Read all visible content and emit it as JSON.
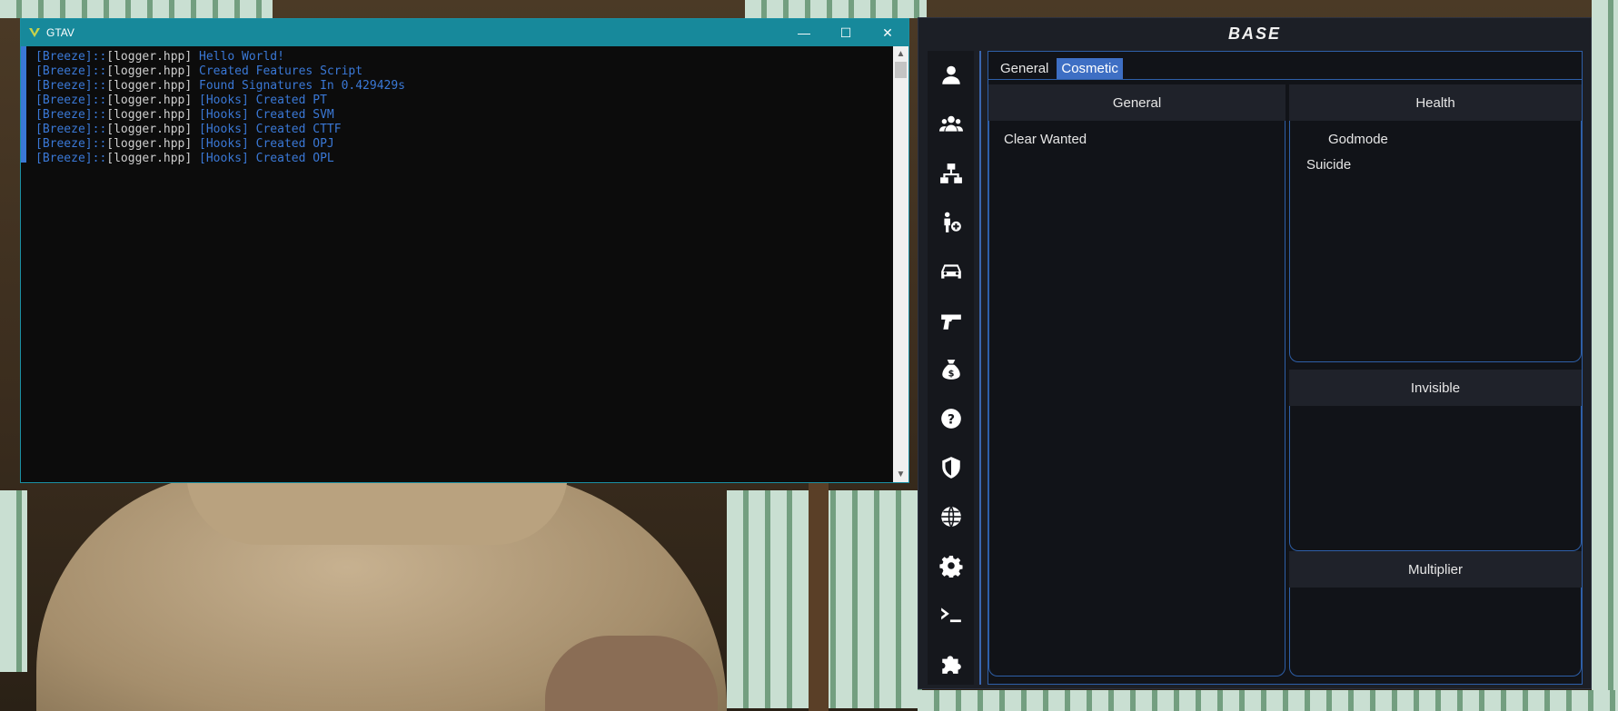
{
  "console": {
    "title": "GTAV",
    "controls": {
      "minimize": "—",
      "maximize": "☐",
      "close": "✕"
    },
    "lines": [
      {
        "tag": "[Breeze]::",
        "file": "[logger.hpp]",
        "msg": " Hello World!"
      },
      {
        "tag": "[Breeze]::",
        "file": "[logger.hpp]",
        "msg": " Created Features Script"
      },
      {
        "tag": "[Breeze]::",
        "file": "[logger.hpp]",
        "msg": " Found Signatures In 0.429429s"
      },
      {
        "tag": "[Breeze]::",
        "file": "[logger.hpp]",
        "msg": " [Hooks] Created PT"
      },
      {
        "tag": "[Breeze]::",
        "file": "[logger.hpp]",
        "msg": " [Hooks] Created SVM"
      },
      {
        "tag": "[Breeze]::",
        "file": "[logger.hpp]",
        "msg": " [Hooks] Created CTTF"
      },
      {
        "tag": "[Breeze]::",
        "file": "[logger.hpp]",
        "msg": " [Hooks] Created OPJ"
      },
      {
        "tag": "[Breeze]::",
        "file": "[logger.hpp]",
        "msg": " [Hooks] Created OPL"
      }
    ]
  },
  "menu": {
    "title": "BASE",
    "sidebar": [
      {
        "icon": "user-icon",
        "active": true
      },
      {
        "icon": "users-icon",
        "active": false
      },
      {
        "icon": "network-icon",
        "active": false
      },
      {
        "icon": "add-ped-icon",
        "active": false
      },
      {
        "icon": "car-icon",
        "active": false
      },
      {
        "icon": "gun-icon",
        "active": false
      },
      {
        "icon": "money-bag-icon",
        "active": false
      },
      {
        "icon": "question-icon",
        "active": false
      },
      {
        "icon": "shield-icon",
        "active": false
      },
      {
        "icon": "globe-icon",
        "active": false
      },
      {
        "icon": "gear-icon",
        "active": false
      },
      {
        "icon": "terminal-icon",
        "active": false
      },
      {
        "icon": "puzzle-icon",
        "active": false
      }
    ],
    "tabs": [
      {
        "label": "General",
        "active": false
      },
      {
        "label": "Cosmetic",
        "active": true
      }
    ],
    "sections": {
      "general": {
        "title": "General",
        "options": [
          "Clear Wanted"
        ]
      },
      "health": {
        "title": "Health",
        "options": [
          "Godmode",
          "Suicide"
        ]
      },
      "invisible": {
        "title": "Invisible"
      },
      "multiplier": {
        "title": "Multiplier"
      }
    }
  },
  "colors": {
    "accent": "#3e6fc4",
    "console_titlebar": "#17899b",
    "console_text_blue": "#3a78d6"
  }
}
